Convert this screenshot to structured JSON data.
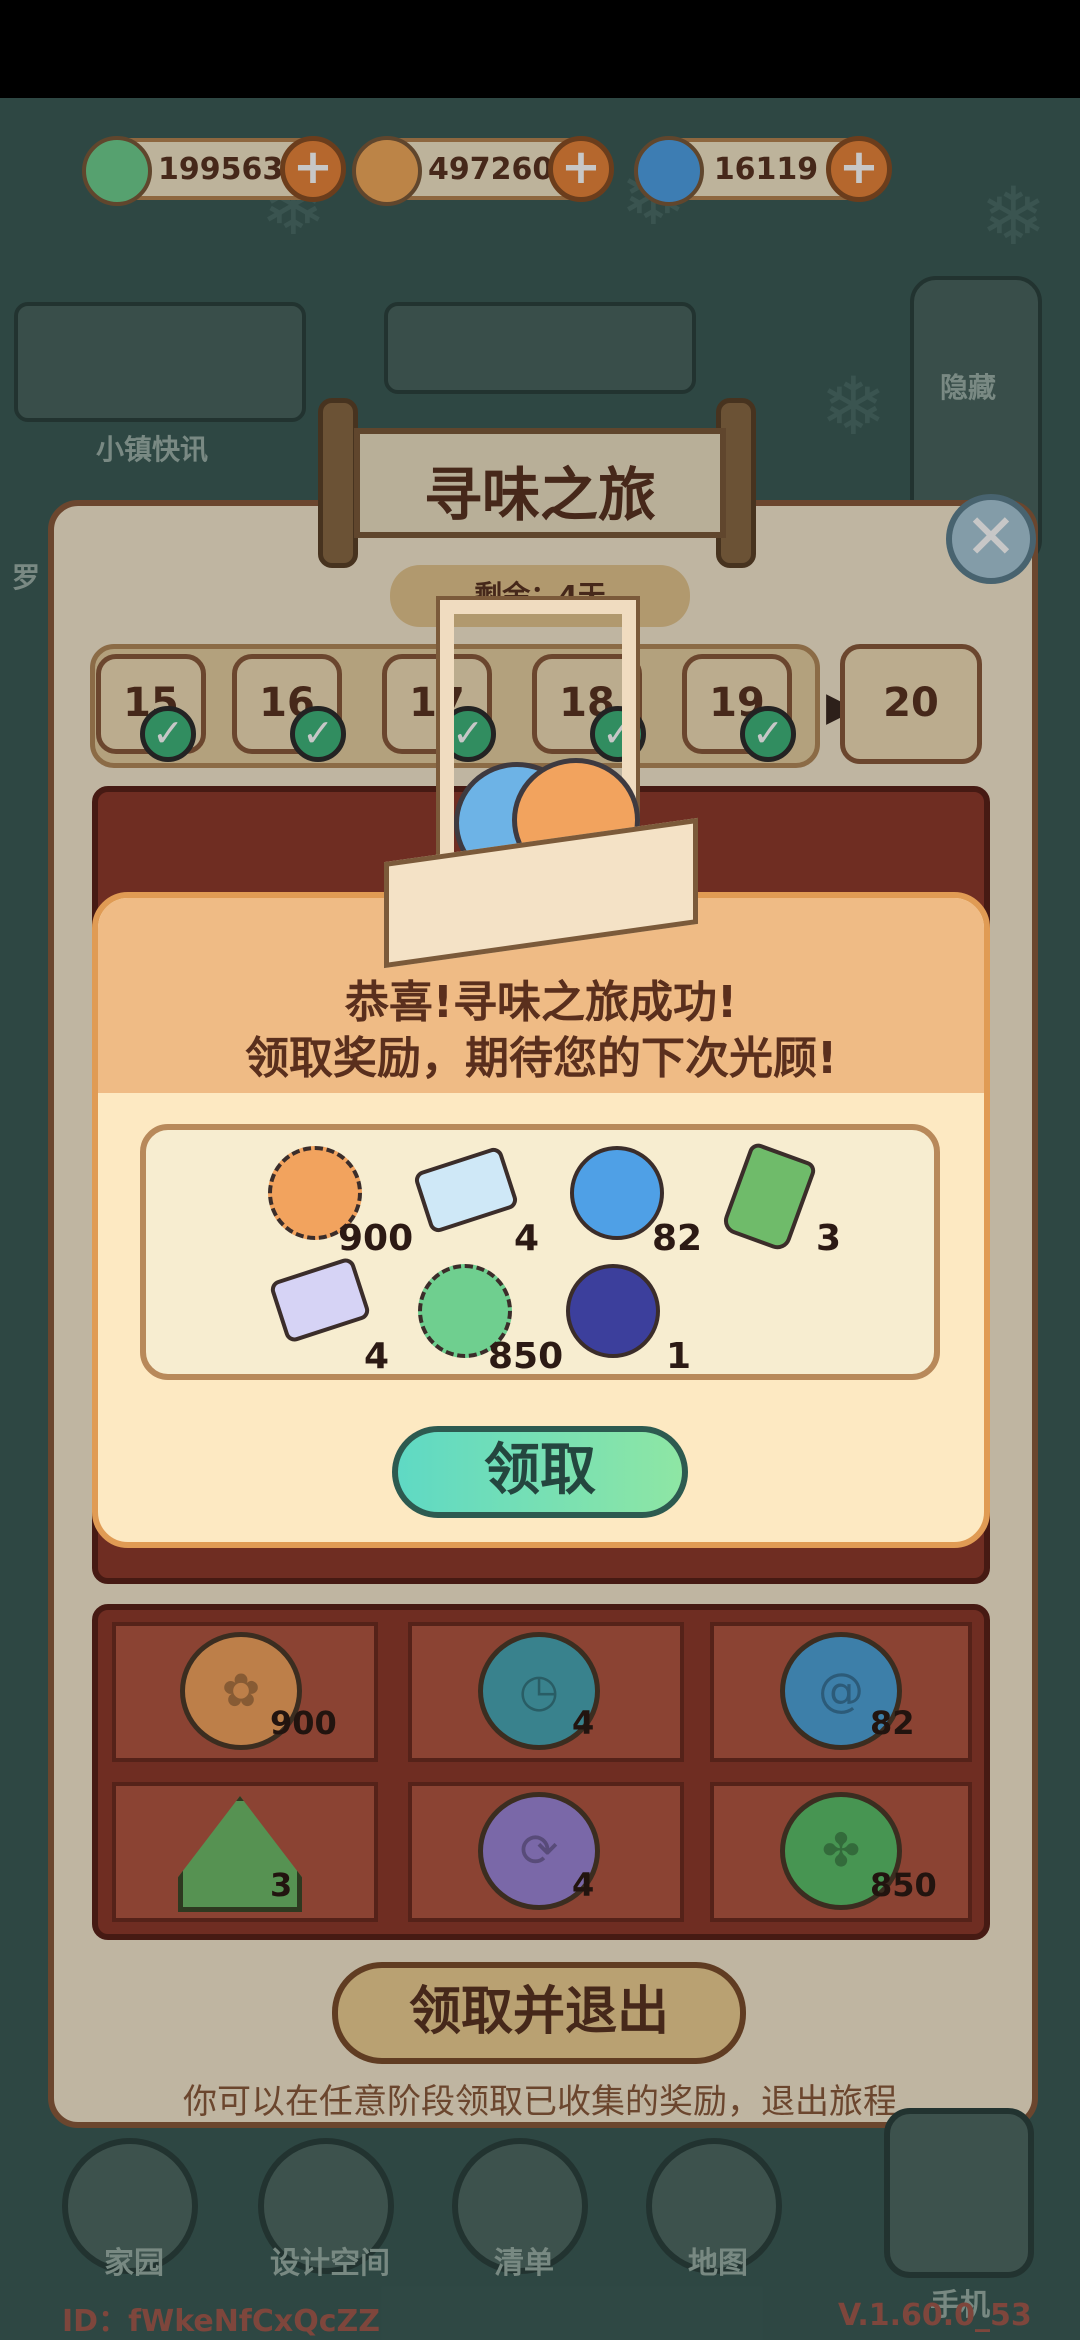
{
  "currencies": [
    {
      "icon": "clover-coin-icon",
      "value": "199563",
      "color": "#6fcf8f"
    },
    {
      "icon": "bean-coin-icon",
      "value": "497260",
      "color": "#f1a95b"
    },
    {
      "icon": "swirl-coin-icon",
      "value": "16119",
      "color": "#4fa0e6"
    }
  ],
  "background": {
    "town_label": "小镇快讯",
    "hide_label": "隐藏",
    "side_label": "罗"
  },
  "event": {
    "title": "寻味之旅",
    "remaining": "剩余：4天",
    "days": [
      "15",
      "16",
      "17",
      "18",
      "19",
      "20"
    ],
    "claim_exit_label": "领取并退出",
    "hint": "你可以在任意阶段领取已收集的奖励，退出旅程",
    "grid": [
      {
        "icon": "orange-mooncake-icon",
        "count": "900",
        "color": "#f2a35e"
      },
      {
        "icon": "teal-mooncake-icon",
        "count": "4",
        "color": "#4aa7b5"
      },
      {
        "icon": "blue-mooncake-icon",
        "count": "82",
        "color": "#4fa3d9"
      },
      {
        "icon": "green-rice-dumpling-icon",
        "count": "3",
        "color": "#6fbb6a"
      },
      {
        "icon": "purple-mooncake-icon",
        "count": "4",
        "color": "#9d86d8"
      },
      {
        "icon": "green-mooncake-icon",
        "count": "850",
        "color": "#5cbf6a"
      }
    ]
  },
  "dialog": {
    "line1": "恭喜!寻味之旅成功!",
    "line2": "领取奖励，期待您的下次光顾!",
    "rewards": [
      {
        "icon": "bean-coin-icon",
        "count": "900",
        "color": "#f2a35e"
      },
      {
        "icon": "ticket-card-icon",
        "count": "4",
        "color": "#cfe8f7"
      },
      {
        "icon": "swirl-coin-icon",
        "count": "82",
        "color": "#4fa0e6"
      },
      {
        "icon": "spray-bottle-icon",
        "count": "3",
        "color": "#6fbb6a"
      },
      {
        "icon": "refresh-card-icon",
        "count": "4",
        "color": "#d6d3f5"
      },
      {
        "icon": "clover-coin-icon",
        "count": "850",
        "color": "#6fcf8f"
      },
      {
        "icon": "vinyl-record-icon",
        "count": "1",
        "color": "#3c3f9c"
      }
    ],
    "claim_label": "领取"
  },
  "nav": {
    "items": [
      "家园",
      "设计空间",
      "清单",
      "地图",
      "手机"
    ]
  },
  "footer": {
    "id": "ID：fWkeNfCxQcZZ",
    "version": "V.1.60.0_53"
  }
}
